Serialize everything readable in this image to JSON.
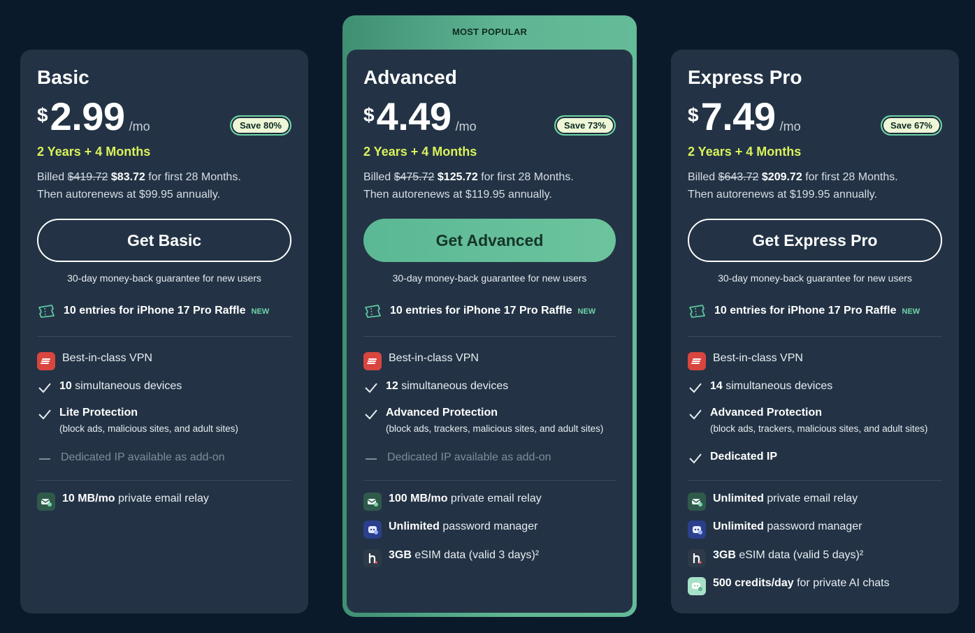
{
  "popular_label": "MOST POPULAR",
  "cards": [
    {
      "name": "Basic",
      "currency": "$",
      "price": "2.99",
      "per": "/mo",
      "save": "Save 80%",
      "term": "2 Years + 4 Months",
      "billed_prefix": "Billed",
      "billed_old": "$419.72",
      "billed_new": "$83.72",
      "billed_suffix": "for first 28 Months.",
      "renew": "Then autorenews at $99.95 annually.",
      "cta": "Get Basic",
      "guarantee": "30-day money-back guarantee for new users",
      "raffle": "10 entries for iPhone 17 Pro Raffle",
      "raffle_badge": "NEW",
      "vpn": "Best-in-class VPN",
      "devices_num": "10",
      "devices_text": "simultaneous devices",
      "protection": "Lite Protection",
      "protection_detail": "(block ads, malicious sites, and adult sites)",
      "dedicated_ip": "Dedicated IP available as add-on",
      "email_bold": "10 MB/mo",
      "email_text": "private email relay"
    },
    {
      "name": "Advanced",
      "currency": "$",
      "price": "4.49",
      "per": "/mo",
      "save": "Save 73%",
      "term": "2 Years + 4 Months",
      "billed_prefix": "Billed",
      "billed_old": "$475.72",
      "billed_new": "$125.72",
      "billed_suffix": "for first 28 Months.",
      "renew": "Then autorenews at $119.95 annually.",
      "cta": "Get Advanced",
      "guarantee": "30-day money-back guarantee for new users",
      "raffle": "10 entries for iPhone 17 Pro Raffle",
      "raffle_badge": "NEW",
      "vpn": "Best-in-class VPN",
      "devices_num": "12",
      "devices_text": "simultaneous devices",
      "protection": "Advanced Protection",
      "protection_detail": "(block ads, trackers, malicious sites, and adult sites)",
      "dedicated_ip": "Dedicated IP available as add-on",
      "email_bold": "100 MB/mo",
      "email_text": "private email relay",
      "pw_bold": "Unlimited",
      "pw_text": "password manager",
      "esim_bold": "3GB",
      "esim_text": "eSIM data (valid 3 days)²"
    },
    {
      "name": "Express Pro",
      "currency": "$",
      "price": "7.49",
      "per": "/mo",
      "save": "Save 67%",
      "term": "2 Years + 4 Months",
      "billed_prefix": "Billed",
      "billed_old": "$643.72",
      "billed_new": "$209.72",
      "billed_suffix": "for first 28 Months.",
      "renew": "Then autorenews at $199.95 annually.",
      "cta": "Get Express Pro",
      "guarantee": "30-day money-back guarantee for new users",
      "raffle": "10 entries for iPhone 17 Pro Raffle",
      "raffle_badge": "NEW",
      "vpn": "Best-in-class VPN",
      "devices_num": "14",
      "devices_text": "simultaneous devices",
      "protection": "Advanced Protection",
      "protection_detail": "(block ads, trackers, malicious sites, and adult sites)",
      "dedicated_ip": "Dedicated IP",
      "email_bold": "Unlimited",
      "email_text": "private email relay",
      "pw_bold": "Unlimited",
      "pw_text": "password manager",
      "esim_bold": "3GB",
      "esim_text": "eSIM data (valid 5 days)²",
      "ai_bold": "500 credits/day",
      "ai_text": "for private AI chats"
    }
  ],
  "colors": {
    "background": "#0b1a2b",
    "card": "#233345",
    "accent_green": "#5fb593",
    "term_yellow": "#d9f25b"
  }
}
